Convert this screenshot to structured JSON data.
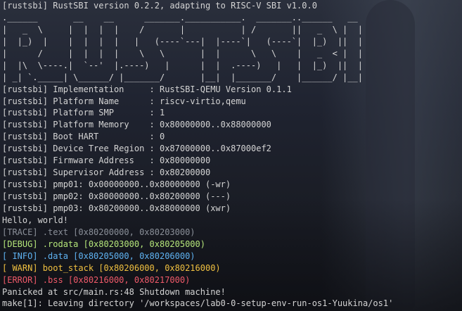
{
  "terminal": {
    "header_line": "[rustsbi] RustSBI version 0.2.2, adapting to RISC-V SBI v1.0.0",
    "logo_lines": [
      ".______       __    __      _______.___________.  _______..______   __",
      "|   _  \\     |  |  |  |    /       |           | /       ||   _  \\ |  |",
      "|  |_)  |    |  |  |  |   |   (----`---|  |----`|   (----`|  |_)  ||  |",
      "|      /     |  |  |  |    \\   \\       |  |      \\   \\    |   _  < |  |",
      "|  |\\  \\----.|  `--'  |.----)   |      |  |  .----)   |   |  |_)  ||  |",
      "| _| `._____| \\______/ |_______/       |__|  |_______/    |______/ |__|"
    ],
    "info_lines": [
      "[rustsbi] Implementation     : RustSBI-QEMU Version 0.1.1",
      "[rustsbi] Platform Name      : riscv-virtio,qemu",
      "[rustsbi] Platform SMP       : 1",
      "[rustsbi] Platform Memory    : 0x80000000..0x88000000",
      "[rustsbi] Boot HART          : 0",
      "[rustsbi] Device Tree Region : 0x87000000..0x87000ef2",
      "[rustsbi] Firmware Address   : 0x80000000",
      "[rustsbi] Supervisor Address : 0x80200000",
      "[rustsbi] pmp01: 0x00000000..0x80000000 (-wr)",
      "[rustsbi] pmp02: 0x80000000..0x80200000 (---)",
      "[rustsbi] pmp03: 0x80200000..0x88000000 (xwr)"
    ],
    "hello": "Hello, world!",
    "log_lines": {
      "trace": "[TRACE] .text [0x80200000, 0x80203000)",
      "debug": "[DEBUG] .rodata [0x80203000, 0x80205000)",
      "info": "[ INFO] .data [0x80205000, 0x80206000)",
      "warn": "[ WARN] boot_stack [0x80206000, 0x80216000)",
      "error": "[ERROR] .bss [0x80216000, 0x80217000)"
    },
    "panic": "Panicked at src/main.rs:48 Shutdown machine!",
    "make_line": "make[1]: Leaving directory '/workspaces/lab0-0-setup-env-run-os1-Yuukina/os1'"
  },
  "colors": {
    "background": "#1a1d26",
    "text": "#d4d4d4",
    "trace": "#8a8f98",
    "debug": "#b5e67a",
    "info": "#5fb3f2",
    "warn": "#f0c040",
    "error": "#f05a6a"
  }
}
